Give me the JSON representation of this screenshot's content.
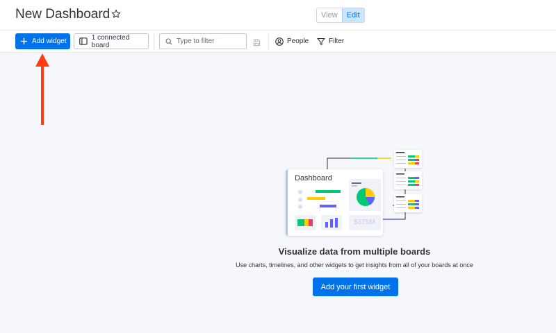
{
  "header": {
    "title": "New Dashboard",
    "view_label": "View",
    "edit_label": "Edit",
    "active_mode": "Edit"
  },
  "toolbar": {
    "add_widget_label": "Add widget",
    "connected_board_label": "1 connected board",
    "filter_placeholder": "Type to filter",
    "people_label": "People",
    "filter_label": "Filter"
  },
  "illustration": {
    "card_title": "Dashboard",
    "amount_label": "$375M"
  },
  "empty_state": {
    "title": "Visualize data from multiple boards",
    "description": "Use charts, timelines, and other widgets to get insights from all of your boards at once",
    "button_label": "Add your first widget"
  },
  "colors": {
    "primary": "#0073ea",
    "annotation_arrow": "#ff3d10",
    "green": "#00c875",
    "yellow": "#ffcb00",
    "purple": "#6161ff",
    "red": "#e2445c"
  },
  "icons": [
    "star-icon",
    "plus-icon",
    "board-icon",
    "search-icon",
    "save-icon",
    "person-icon",
    "filter-icon"
  ]
}
